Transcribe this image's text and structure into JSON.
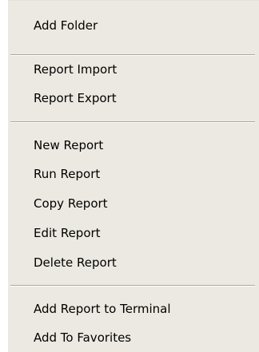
{
  "context_menu": {
    "groups": [
      {
        "items": [
          {
            "label": "Add Folder"
          }
        ]
      },
      {
        "items": [
          {
            "label": "Report Import"
          },
          {
            "label": "Report Export"
          }
        ]
      },
      {
        "items": [
          {
            "label": "New Report"
          },
          {
            "label": "Run Report"
          },
          {
            "label": "Copy Report"
          },
          {
            "label": "Edit Report"
          },
          {
            "label": "Delete Report"
          }
        ]
      },
      {
        "items": [
          {
            "label": "Add Report to Terminal"
          },
          {
            "label": "Add To Favorites"
          }
        ]
      }
    ]
  },
  "colors": {
    "menu_background": "#ebe9e1",
    "separator_shadow": "#a8a7a1",
    "separator_highlight": "#ffffff",
    "text": "#000000"
  }
}
